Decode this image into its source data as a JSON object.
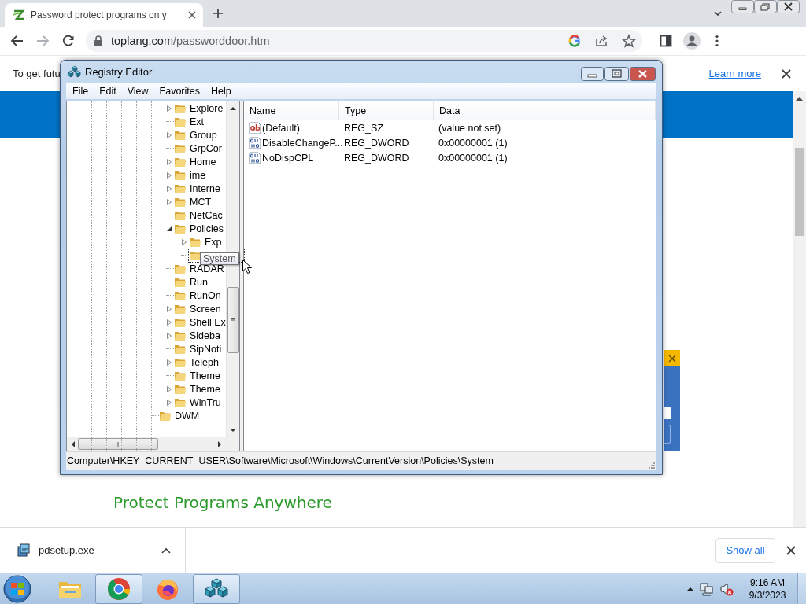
{
  "browser": {
    "tab": {
      "title": "Password protect programs on y",
      "selected": true
    },
    "address": {
      "host": "toplang.com",
      "path": "/passworddoor.htm"
    },
    "infobar": {
      "text": "To get futu",
      "link": "Learn more"
    },
    "page": {
      "heading": "Protect Programs Anywhere"
    },
    "downloads": {
      "items": [
        {
          "name": "pdsetup.exe"
        }
      ],
      "show_all": "Show all"
    }
  },
  "regedit": {
    "title": "Registry Editor",
    "menu": [
      "File",
      "Edit",
      "View",
      "Favorites",
      "Help"
    ],
    "tree": {
      "items": [
        {
          "label": "Explore",
          "expandable": true,
          "expanded": false,
          "selected": false,
          "hovered": false
        },
        {
          "label": "Ext",
          "expandable": false,
          "expanded": false,
          "selected": false,
          "hovered": false
        },
        {
          "label": "Group",
          "expandable": true,
          "expanded": false,
          "selected": false,
          "hovered": false
        },
        {
          "label": "GrpCor",
          "expandable": false,
          "expanded": false,
          "selected": false,
          "hovered": false
        },
        {
          "label": "Home",
          "expandable": true,
          "expanded": false,
          "selected": false,
          "hovered": false
        },
        {
          "label": "ime",
          "expandable": true,
          "expanded": false,
          "selected": false,
          "hovered": false
        },
        {
          "label": "Interne",
          "expandable": true,
          "expanded": false,
          "selected": false,
          "hovered": false
        },
        {
          "label": "MCT",
          "expandable": true,
          "expanded": false,
          "selected": false,
          "hovered": false
        },
        {
          "label": "NetCac",
          "expandable": false,
          "expanded": false,
          "selected": false,
          "hovered": false
        },
        {
          "label": "Policies",
          "expandable": true,
          "expanded": true,
          "selected": false,
          "hovered": false,
          "children": [
            {
              "label": "Exp",
              "expandable": true,
              "expanded": false,
              "selected": false,
              "hovered": false
            },
            {
              "label": "System",
              "expandable": false,
              "expanded": false,
              "selected": true,
              "hovered": true
            }
          ]
        },
        {
          "label": "RADAR",
          "expandable": false,
          "expanded": false,
          "selected": false,
          "hovered": false
        },
        {
          "label": "Run",
          "expandable": false,
          "expanded": false,
          "selected": false,
          "hovered": false
        },
        {
          "label": "RunOn",
          "expandable": false,
          "expanded": false,
          "selected": false,
          "hovered": false
        },
        {
          "label": "Screen",
          "expandable": true,
          "expanded": false,
          "selected": false,
          "hovered": false
        },
        {
          "label": "Shell Ex",
          "expandable": true,
          "expanded": false,
          "selected": false,
          "hovered": false
        },
        {
          "label": "Sideba",
          "expandable": true,
          "expanded": false,
          "selected": false,
          "hovered": false
        },
        {
          "label": "SipNoti",
          "expandable": false,
          "expanded": false,
          "selected": false,
          "hovered": false
        },
        {
          "label": "Teleph",
          "expandable": true,
          "expanded": false,
          "selected": false,
          "hovered": false
        },
        {
          "label": "Theme",
          "expandable": false,
          "expanded": false,
          "selected": false,
          "hovered": false
        },
        {
          "label": "Theme",
          "expandable": true,
          "expanded": false,
          "selected": false,
          "hovered": false
        },
        {
          "label": "WinTru",
          "expandable": true,
          "expanded": false,
          "selected": false,
          "hovered": false
        }
      ],
      "outer_items": [
        {
          "label": "DWM",
          "expandable": false,
          "expanded": false,
          "selected": false,
          "hovered": false
        }
      ]
    },
    "columns": [
      "Name",
      "Type",
      "Data"
    ],
    "values": [
      {
        "kind": "string",
        "name": "(Default)",
        "type": "REG_SZ",
        "data": "(value not set)"
      },
      {
        "kind": "dword",
        "name": "DisableChangeP...",
        "type": "REG_DWORD",
        "data": "0x00000001 (1)"
      },
      {
        "kind": "dword",
        "name": "NoDispCPL",
        "type": "REG_DWORD",
        "data": "0x00000001 (1)"
      }
    ],
    "status": "Computer\\HKEY_CURRENT_USER\\Software\\Microsoft\\Windows\\CurrentVersion\\Policies\\System"
  },
  "taskbar": {
    "apps": [
      {
        "kind": "explorer",
        "selected": false
      },
      {
        "kind": "chrome",
        "selected": true
      },
      {
        "kind": "firefox",
        "selected": false
      },
      {
        "kind": "regedit",
        "selected": true
      }
    ],
    "time": "9:16 AM",
    "date": "9/3/2023"
  }
}
